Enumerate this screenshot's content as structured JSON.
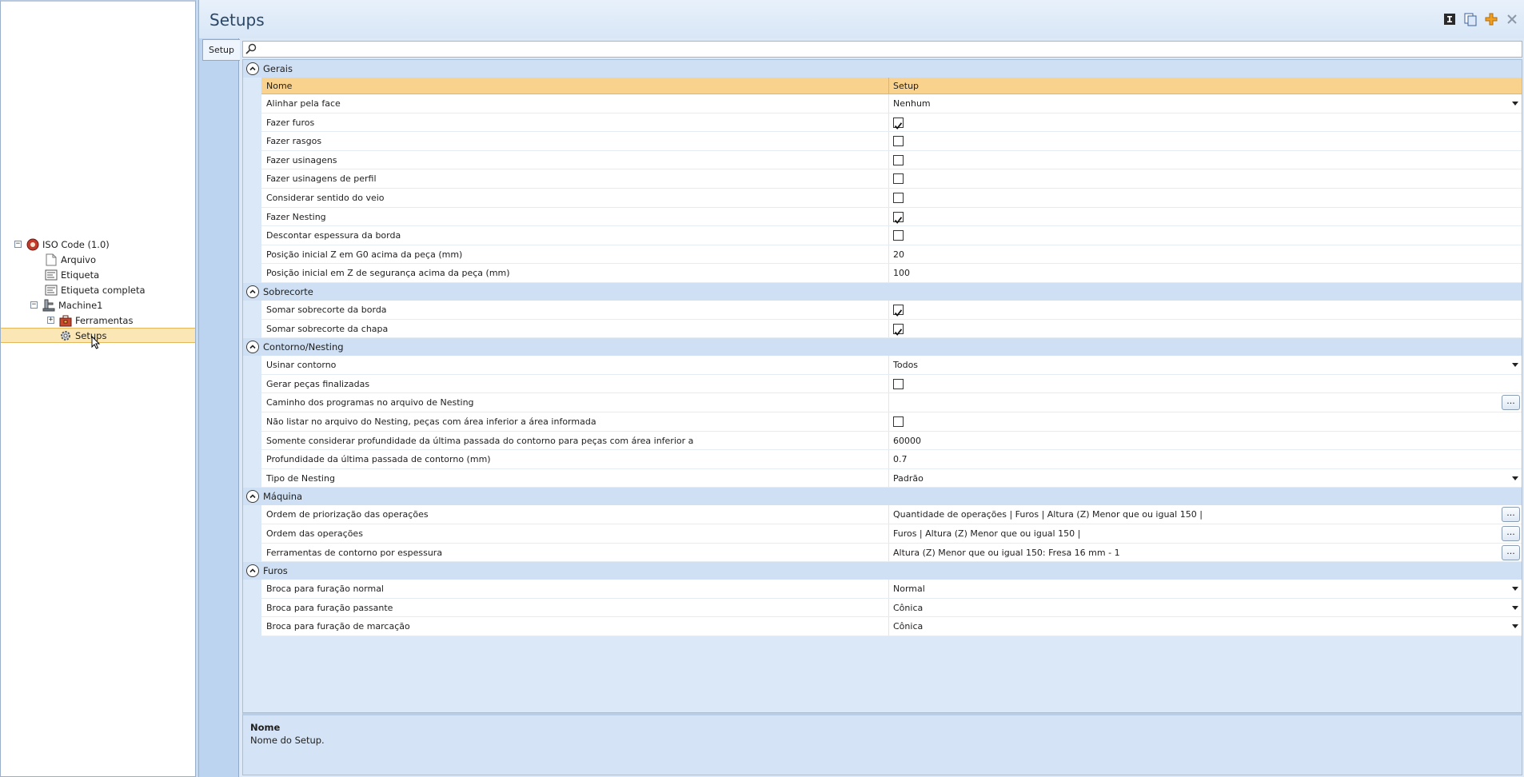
{
  "tree": {
    "root": "ISO Code (1.0)",
    "items": {
      "arquivo": "Arquivo",
      "etiqueta": "Etiqueta",
      "etiqueta_completa": "Etiqueta completa",
      "machine": "Machine1",
      "ferramentas": "Ferramentas",
      "setups": "Setups"
    },
    "expander_minus": "−",
    "expander_plus": "+"
  },
  "header": {
    "title": "Setups",
    "buttons": [
      "info-icon",
      "copy-icon",
      "add-icon",
      "close-icon"
    ],
    "accent_color": "#f0a020"
  },
  "tabs": {
    "setup": "Setup"
  },
  "search": {
    "placeholder": ""
  },
  "grid": {
    "columns": {
      "name": "Nome",
      "value": "Setup"
    },
    "categories": [
      {
        "label": "Gerais",
        "properties": [
          {
            "name": "Alinhar pela face",
            "type": "dropdown",
            "value": "Nenhum"
          },
          {
            "name": "Fazer furos",
            "type": "checkbox",
            "checked": true
          },
          {
            "name": "Fazer rasgos",
            "type": "checkbox",
            "checked": false
          },
          {
            "name": "Fazer usinagens",
            "type": "checkbox",
            "checked": false
          },
          {
            "name": "Fazer usinagens de perfil",
            "type": "checkbox",
            "checked": false
          },
          {
            "name": "Considerar sentido do veio",
            "type": "checkbox",
            "checked": false
          },
          {
            "name": "Fazer Nesting",
            "type": "checkbox",
            "checked": true
          },
          {
            "name": "Descontar espessura da borda",
            "type": "checkbox",
            "checked": false
          },
          {
            "name": "Posição inicial Z em G0 acima da peça (mm)",
            "type": "text",
            "value": "20"
          },
          {
            "name": "Posição inicial em Z de segurança acima da peça (mm)",
            "type": "text",
            "value": "100"
          }
        ]
      },
      {
        "label": "Sobrecorte",
        "properties": [
          {
            "name": "Somar sobrecorte da borda",
            "type": "checkbox",
            "checked": true
          },
          {
            "name": "Somar sobrecorte da chapa",
            "type": "checkbox",
            "checked": true
          }
        ]
      },
      {
        "label": "Contorno/Nesting",
        "properties": [
          {
            "name": "Usinar contorno",
            "type": "dropdown",
            "value": "Todos"
          },
          {
            "name": "Gerar peças finalizadas",
            "type": "checkbox",
            "checked": false
          },
          {
            "name": "Caminho dos programas no arquivo de Nesting",
            "type": "ellipsis",
            "value": ""
          },
          {
            "name": "Não listar no arquivo do Nesting, peças com área inferior a área informada",
            "type": "checkbox",
            "checked": false
          },
          {
            "name": "Somente considerar profundidade da última passada do contorno para peças com área inferior a",
            "type": "text",
            "value": "60000"
          },
          {
            "name": "Profundidade da última passada de contorno (mm)",
            "type": "text",
            "value": "0.7"
          },
          {
            "name": "Tipo de Nesting",
            "type": "dropdown",
            "value": "Padrão"
          }
        ]
      },
      {
        "label": "Máquina",
        "properties": [
          {
            "name": "Ordem de priorização das operações",
            "type": "ellipsis",
            "value": "Quantidade de operações | Furos | Altura (Z) Menor que ou igual 150 |"
          },
          {
            "name": "Ordem das operações",
            "type": "ellipsis",
            "value": "Furos | Altura (Z) Menor que ou igual 150 |"
          },
          {
            "name": "Ferramentas de contorno por espessura",
            "type": "ellipsis",
            "value": "Altura (Z) Menor que ou igual 150: Fresa 16 mm - 1"
          }
        ]
      },
      {
        "label": "Furos",
        "properties": [
          {
            "name": "Broca para furação normal",
            "type": "dropdown",
            "value": "Normal"
          },
          {
            "name": "Broca para furação passante",
            "type": "dropdown",
            "value": "Cônica"
          },
          {
            "name": "Broca para furação de marcação",
            "type": "dropdown",
            "value": "Cônica"
          }
        ]
      }
    ],
    "ellipsis_label": "..."
  },
  "description": {
    "title": "Nome",
    "text": "Nome do Setup."
  }
}
